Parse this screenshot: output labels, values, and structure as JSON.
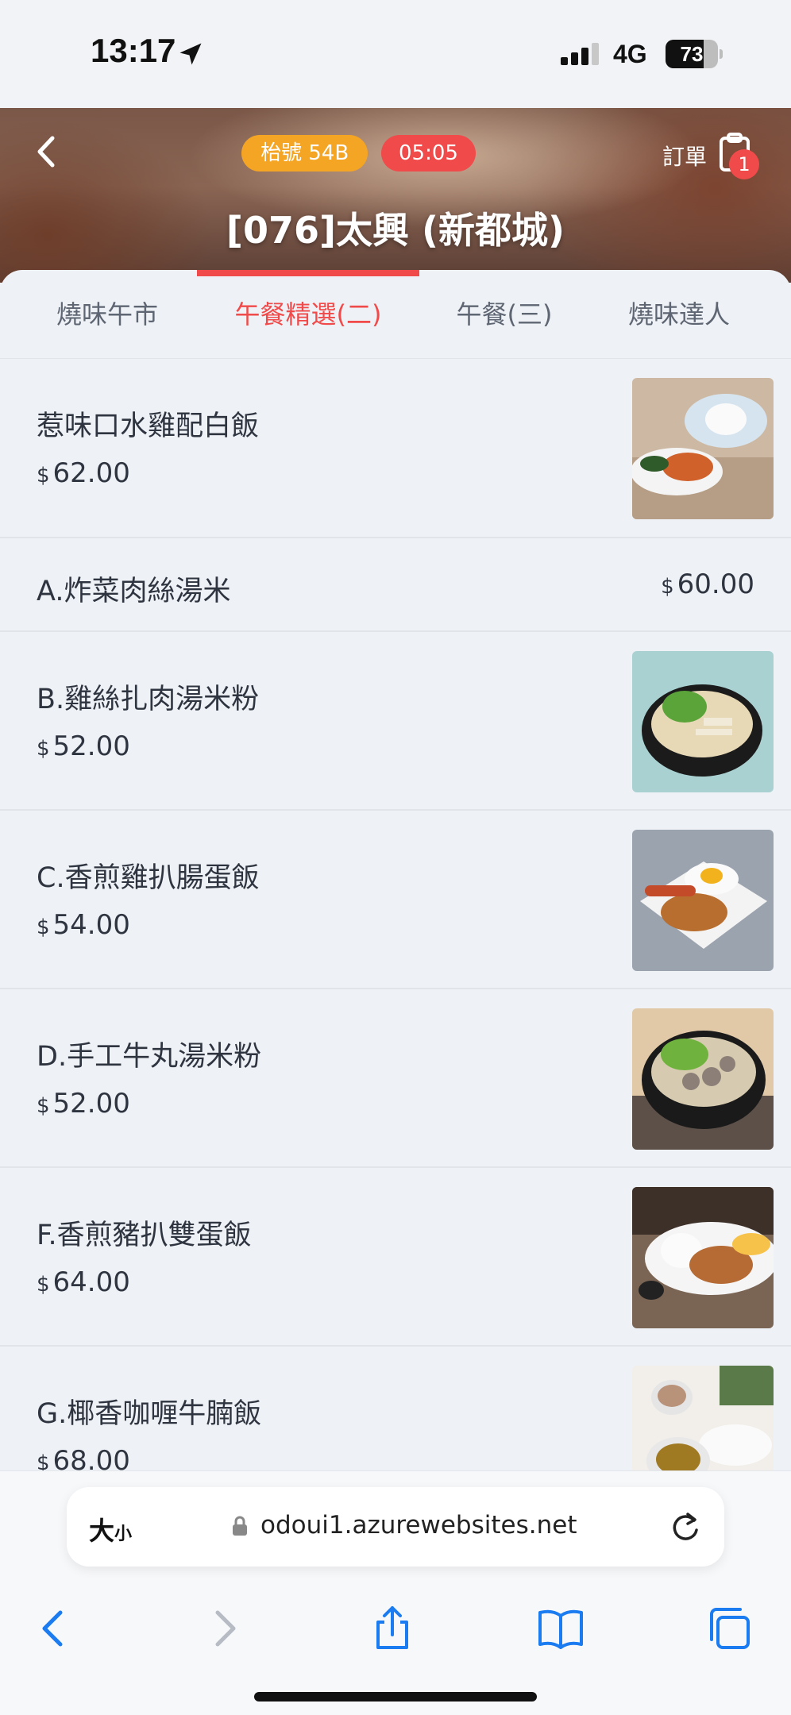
{
  "status": {
    "time": "13:17",
    "network": "4G",
    "battery": "73",
    "battery_level": 0.73
  },
  "header": {
    "table_badge": "枱號  54B",
    "time_badge": "05:05",
    "order_label": "訂單",
    "order_count": "1",
    "store_title": "[076]太興 (新都城)"
  },
  "tabs": [
    {
      "label": "燒味午市",
      "active": false
    },
    {
      "label": "午餐精選(二)",
      "active": true
    },
    {
      "label": "午餐(三)",
      "active": false
    },
    {
      "label": "燒味達人",
      "active": false
    }
  ],
  "items": [
    {
      "name": "惹味口水雞配白飯",
      "currency": "$",
      "price": "62.00",
      "image": "chicken-rice-photo"
    },
    {
      "name": "A.炸菜肉絲湯米",
      "currency": "$",
      "price": "60.00",
      "image": null
    },
    {
      "name": "B.雞絲扎肉湯米粉",
      "currency": "$",
      "price": "52.00",
      "image": "noodle-soup-photo"
    },
    {
      "name": "C.香煎雞扒腸蛋飯",
      "currency": "$",
      "price": "54.00",
      "image": "chicken-chop-photo"
    },
    {
      "name": "D.手工牛丸湯米粉",
      "currency": "$",
      "price": "52.00",
      "image": "beef-ball-noodle-photo"
    },
    {
      "name": "F.香煎豬扒雙蛋飯",
      "currency": "$",
      "price": "64.00",
      "image": "pork-chop-photo"
    },
    {
      "name": "G.椰香咖喱牛腩飯",
      "currency": "$",
      "price": "68.00",
      "image": "curry-beef-photo"
    }
  ],
  "browser": {
    "text_size_big": "大",
    "text_size_small": "小",
    "url": "odoui1.azurewebsites.net"
  },
  "colors": {
    "accent": "#f04a4a",
    "badge_orange": "#f5a524"
  }
}
